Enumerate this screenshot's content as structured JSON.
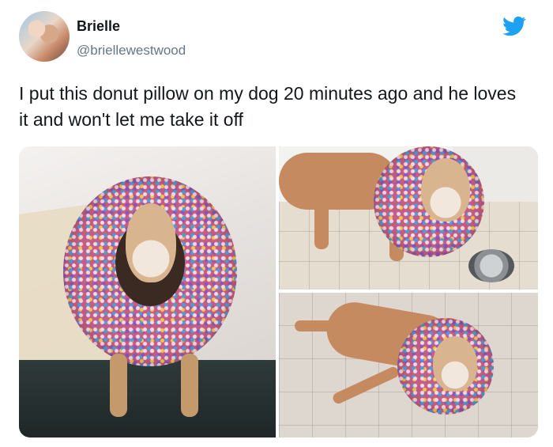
{
  "tweet": {
    "author": {
      "name": "Brielle",
      "handle": "@briellewestwood",
      "avatar_icon": "user-avatar-icon"
    },
    "brand_icon": "twitter-bird-icon",
    "brand_color": "#1da1f2",
    "text": "I put this donut pillow on my dog 20 minutes ago and he loves it and won't let me take it off"
  },
  "media": {
    "count": 3,
    "items": [
      {
        "subject": "dog-donut-bed-photo"
      },
      {
        "subject": "dog-donut-standing-photo"
      },
      {
        "subject": "dog-donut-lying-photo"
      }
    ]
  }
}
